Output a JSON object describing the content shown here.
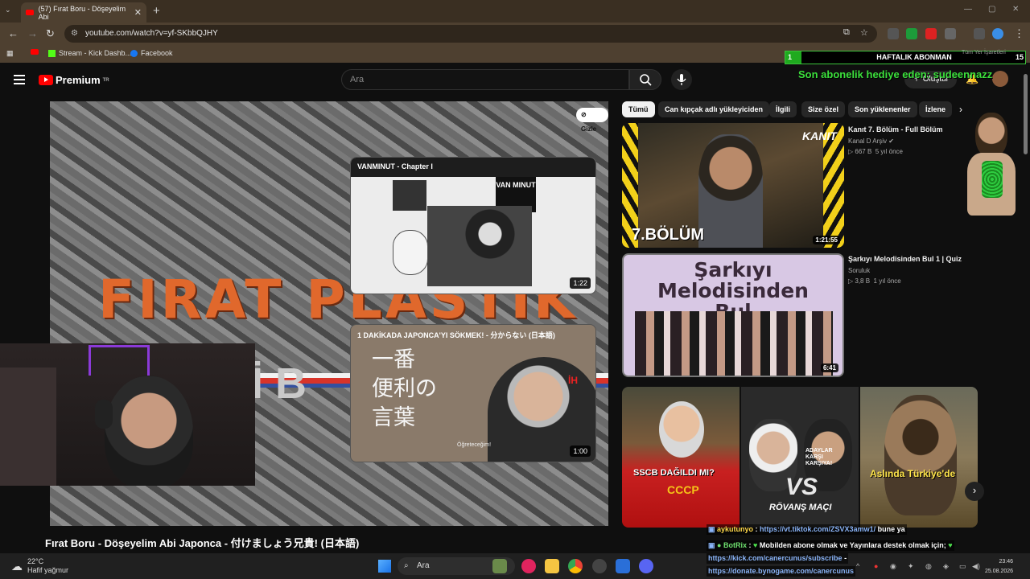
{
  "browser": {
    "tab_title": "(57) Fırat Boru - Döşeyelim Abi",
    "url": "youtube.com/watch?v=yf-SKbbQJHY",
    "bookmarks": [
      {
        "label": "Stream - Kick Dashb..."
      },
      {
        "label": "Facebook"
      }
    ],
    "all_bookmarks_label": "Tüm Yer İşaretleri"
  },
  "header": {
    "logo_text": "Premium",
    "logo_badge": "TR",
    "search_placeholder": "Ara",
    "create_label": "Oluştur"
  },
  "overlay": {
    "weekly_current": "1",
    "weekly_label": "HAFTALIK ABONMAN",
    "weekly_goal": "15",
    "last_sub": "Son abonelik hediye eden: sudeennazz"
  },
  "player": {
    "hide_label": "Gizle",
    "bg_text_1": "FIRAT PLASTİK",
    "bg_text_2": "İ B",
    "cards": [
      {
        "title": "VANMINUT - Chapter I",
        "duration": "1:22",
        "sign": "VAN MINUT"
      },
      {
        "title": "1 DAKİKADA JAPONCA'YI SÖKMEK! - 分からない (日本語)",
        "duration": "1:00",
        "jp_lines": [
          "一番",
          "便利の",
          "言葉"
        ],
        "caption": "Öğreteceğim!"
      }
    ]
  },
  "video_title": "Fırat Boru - Döşeyelim Abi Japonca - 付けましょう兄貴! (日本語)",
  "chips": [
    "Tümü",
    "Can kıpçak adlı yükleyiciden",
    "İlgili",
    "Size özel",
    "Son yüklenenler",
    "İzlene"
  ],
  "recommendations": [
    {
      "title": "Kanıt 7. Bölüm - Full Bölüm",
      "channel": "Kanal D Arşiv",
      "views": "667 B",
      "age": "5 yıl önce",
      "duration": "1:21:55",
      "thumb_text": "7.BÖLÜM",
      "brand": "KANIT"
    },
    {
      "title": "Şarkıyı Melodisinden Bul 1 | Quiz",
      "channel": "Soruluk",
      "views": "3,8 B",
      "age": "1 yıl önce",
      "duration": "6:41",
      "thumb_lines": [
        "Şarkıyı",
        "Melodisinden",
        "Bul"
      ]
    }
  ],
  "shorts": [
    {
      "caption": "SSCB DAĞILDI MI?",
      "sub": "СССР"
    },
    {
      "caption": "RÖVANŞ MAÇI",
      "sub": "ADAYLAR KARŞI KARŞIYA!"
    },
    {
      "caption": "Aslında Türkiye'de"
    }
  ],
  "chat": [
    {
      "user": "aykutunyo",
      "text_link": "https://vt.tiktok.com/ZSVX3amw1/",
      "text": "bune ya"
    },
    {
      "user": "BotRix",
      "text": "Mobilden abone olmak ve Yayınlara destek olmak için;",
      "link1": "https://kick.com/canercunus/subscribe",
      "link2": "https://donate.bynogame.com/canercunus"
    }
  ],
  "taskbar": {
    "temp": "22°C",
    "weather": "Hafif yağmur",
    "search_label": "Ara",
    "time": "23:46",
    "date": "25.08.2026"
  },
  "colors": {
    "youtube_red": "#ff0000",
    "chat_user": "#ffd84a",
    "overlay_green": "#3ce03c"
  }
}
